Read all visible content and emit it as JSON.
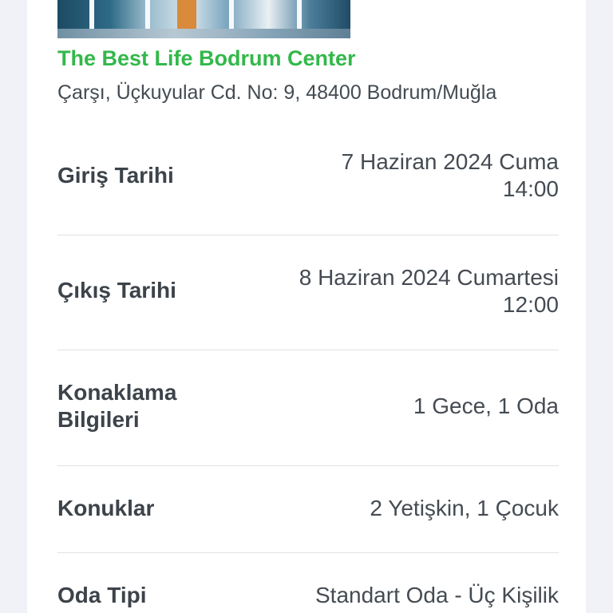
{
  "hotel": {
    "name": "The Best Life Bodrum Center",
    "address": "Çarşı, Üçkuyular Cd. No: 9, 48400 Bodrum/Muğla"
  },
  "details": {
    "checkin": {
      "label": "Giriş Tarihi",
      "value_date": "7 Haziran 2024 Cuma",
      "value_time": "14:00"
    },
    "checkout": {
      "label": "Çıkış Tarihi",
      "value_date": "8 Haziran 2024 Cumartesi",
      "value_time": "12:00"
    },
    "stay": {
      "label_line1": "Konaklama",
      "label_line2": "Bilgileri",
      "value": "1 Gece, 1 Oda"
    },
    "guests": {
      "label": "Konuklar",
      "value": "2 Yetişkin, 1 Çocuk"
    },
    "room_type": {
      "label": "Oda Tipi",
      "value": "Standart Oda - Üç Kişilik"
    }
  },
  "colors": {
    "hotel_name": "#33b84a",
    "label_text": "#3d434a",
    "value_text": "#454b52",
    "divider": "#dfe2e6",
    "page_bg": "#f1f2f7"
  }
}
